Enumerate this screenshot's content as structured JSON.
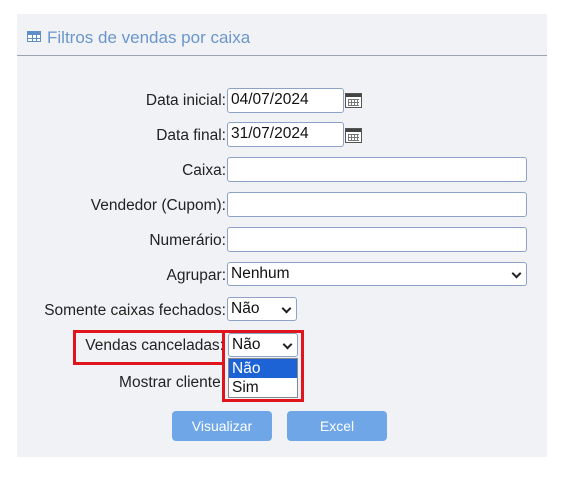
{
  "panel": {
    "title": "Filtros de vendas por caixa",
    "title_icon": "table-icon"
  },
  "form": {
    "data_inicial": {
      "label": "Data inicial:",
      "value": "04/07/2024",
      "icon": "calendar-icon"
    },
    "data_final": {
      "label": "Data final:",
      "value": "31/07/2024",
      "icon": "calendar-icon"
    },
    "caixa": {
      "label": "Caixa:",
      "value": ""
    },
    "vendedor": {
      "label": "Vendedor (Cupom):",
      "value": ""
    },
    "numerario": {
      "label": "Numerário:",
      "value": ""
    },
    "agrupar": {
      "label": "Agrupar:",
      "selected": "Nenhum"
    },
    "somente_fechados": {
      "label": "Somente caixas fechados:",
      "selected": "Não"
    },
    "vendas_canceladas": {
      "label": "Vendas canceladas:",
      "selected": "Não",
      "options": [
        "Não",
        "Sim"
      ],
      "highlighted_option": "Não"
    },
    "mostrar_cliente": {
      "label": "Mostrar cliente:"
    }
  },
  "buttons": {
    "visualizar": "Visualizar",
    "excel": "Excel"
  },
  "colors": {
    "accent": "#6b96cc",
    "button": "#6ea6e8",
    "highlight": "#e0141c",
    "option_active": "#1e63d6",
    "panel_bg": "#f0f2f5"
  }
}
